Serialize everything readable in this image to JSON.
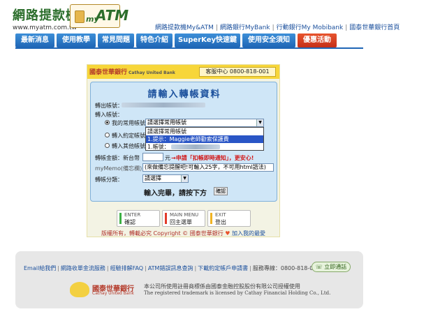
{
  "header": {
    "brand_title": "網路提款機",
    "brand_url": "www.myatm.com.tw",
    "logo_my": "my",
    "logo_atm": "ATM",
    "top_links": [
      "網路提款機My&ATM",
      "網路銀行MyBank",
      "行動銀行My Mobibank",
      "國泰世華銀行首頁"
    ]
  },
  "nav": {
    "items": [
      "最新消息",
      "使用教學",
      "常見問題",
      "特色介紹",
      "SuperKey快速鍵",
      "使用安全須知",
      "優惠活動"
    ]
  },
  "panel": {
    "bank_name": "國泰世華銀行",
    "bank_name_en": "Cathay United Bank",
    "service_text": "客服中心 0800-818-001",
    "form_title": "請輸入轉帳資料",
    "out_account_label": "轉出帳號：",
    "in_account_label": "轉入帳號：",
    "option_common": "我的常用帳號",
    "option_agreed": "轉入約定帳號",
    "option_other": "轉入其他帳號",
    "account_select_value": "請選擇常用帳號",
    "dropdown_options": [
      "請選擇常用帳號",
      "1.提示：Maggie老師勸索保護費",
      "1.帳號："
    ],
    "amount_label": "轉帳金額：新台幣",
    "amount_unit": "元",
    "amount_note": "→申請「扣帳即時通知」，更安心!",
    "memo_label": "myMemo(備忘欄)：",
    "memo_placeholder": "(來做備忘提醒吧!可輸入25字，不可用html語法)",
    "category_label": "轉帳分類：",
    "category_value": "請選擇",
    "submit_hint": "輸入完畢，請按下方",
    "confirm_label": "確認",
    "buttons": [
      {
        "en": "ENTER",
        "zh": "確認",
        "color": "#3cb043"
      },
      {
        "en": "MAIN MENU",
        "zh": "回主選單",
        "color": "#e23b2a"
      },
      {
        "en": "EXIT",
        "zh": "登出",
        "color": "#f0b323"
      }
    ],
    "copyright": "版權所有，轉載必究 Copyright © 國泰世華銀行",
    "favorite": "加入我的最愛"
  },
  "footer": {
    "links": [
      "Email給我們",
      "網路收單金流服務",
      "經驗排解FAQ",
      "ATM錯誤訊息查詢",
      "下載約定帳戶申請書"
    ],
    "hotline": "服務專線：0800-818-001",
    "call_button": "立即通話",
    "logo_zh": "國泰世華銀行",
    "logo_en": "Cathay United Bank",
    "note_zh": "本公司所使用註冊商標係由國泰金融控股股份有限公司授權使用",
    "note_en": "The registered trademark is licensed by Cathay Financial Holding Co., Ltd."
  },
  "colors": {
    "nav_blue": "#1f66b6",
    "nav_red": "#c4301a",
    "panel_yellow": "#f7d63a",
    "form_blue": "#cfe6f7"
  }
}
